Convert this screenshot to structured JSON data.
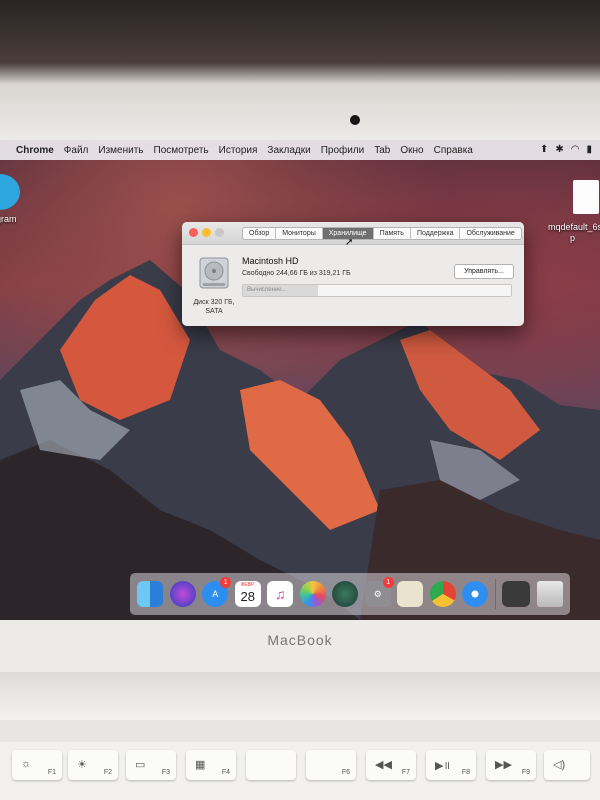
{
  "menubar": {
    "app": "Chrome",
    "items": [
      "Файл",
      "Изменить",
      "Посмотреть",
      "История",
      "Закладки",
      "Профили",
      "Tab",
      "Окно",
      "Справка"
    ]
  },
  "desktop": {
    "left_icon_label": "gram",
    "right_file_label_line1": "mqdefault_6s",
    "right_file_label_line2": "p"
  },
  "about_window": {
    "tabs": [
      "Обзор",
      "Мониторы",
      "Хранилище",
      "Память",
      "Поддержка",
      "Обслуживание"
    ],
    "active_tab": "Хранилище",
    "disk_label_line1": "Диск 320 ГБ,",
    "disk_label_line2": "SATA",
    "volume_name": "Macintosh HD",
    "free_text": "Свободно 244,66 ГБ из 319,21 ГБ",
    "manage_button": "Управлять...",
    "bar_label": "Вычисление...",
    "bar_progress_fraction": 0.28
  },
  "dock": {
    "calendar_month": "ФЕВР.",
    "calendar_day": "28",
    "appstore_badge": "1",
    "prefs_badge": "1"
  },
  "bezel": {
    "brand": "MacBook"
  },
  "keyboard": {
    "keys": [
      {
        "glyph": "☼",
        "label": "F1"
      },
      {
        "glyph": "☀",
        "label": "F2"
      },
      {
        "glyph": "▭",
        "label": "F3"
      },
      {
        "glyph": "▦",
        "label": "F4"
      },
      {
        "glyph": "",
        "label": ""
      },
      {
        "glyph": "",
        "label": "F6"
      },
      {
        "glyph": "◀◀",
        "label": "F7"
      },
      {
        "glyph": "▶॥",
        "label": "F8"
      },
      {
        "glyph": "▶▶",
        "label": "F9"
      },
      {
        "glyph": "",
        "label": ""
      },
      {
        "glyph": "◁)",
        "label": ""
      }
    ]
  },
  "colors": {
    "accent_red": "#fc5f57",
    "accent_yellow": "#fdbd2e",
    "active_tab": "#6f6f6f"
  }
}
